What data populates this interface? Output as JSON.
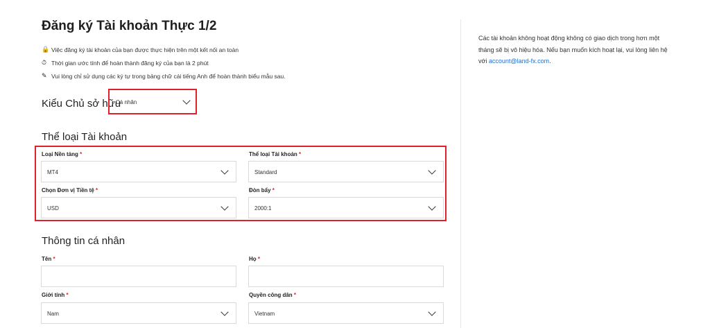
{
  "page": {
    "title": "Đăng ký Tài khoản Thực 1/2",
    "notes": [
      {
        "icon": "lock-icon",
        "glyph": "🔒",
        "text": "Việc đăng ký tài khoản của bạn được thực hiện trên một kết nối an toàn"
      },
      {
        "icon": "stopwatch-icon",
        "glyph": "⏱",
        "text": "Thời gian ước tính để hoàn thành đăng ký của bạn là 2 phút"
      },
      {
        "icon": "pencil-icon",
        "glyph": "✎",
        "text": "Vui lòng chỉ sử dụng các ký tự trong bảng chữ cái tiếng Anh để hoàn thành biểu mẫu sau."
      }
    ]
  },
  "owner": {
    "label": "Kiểu Chủ sở hữu",
    "value": "Cá nhân"
  },
  "account": {
    "heading": "Thể loại Tài khoản",
    "platform": {
      "label": "Loại Nền tảng",
      "value": "MT4"
    },
    "type": {
      "label": "Thể loại Tài khoản",
      "value": "Standard"
    },
    "currency": {
      "label": "Chọn Đơn vị Tiền tệ",
      "value": "USD"
    },
    "leverage": {
      "label": "Đòn bẩy",
      "value": "2000:1"
    }
  },
  "personal": {
    "heading": "Thông tin cá nhân",
    "first_name": {
      "label": "Tên",
      "value": ""
    },
    "last_name": {
      "label": "Họ",
      "value": ""
    },
    "gender": {
      "label": "Giới tính",
      "value": "Nam"
    },
    "citizenship": {
      "label": "Quyền công dân",
      "value": "Vietnam"
    }
  },
  "required_mark": "*",
  "sidebar": {
    "text": "Các tài khoản không hoạt động không có giao dịch trong hơn một tháng sẽ bị vô hiệu hóa. Nếu bạn muốn kích hoạt lại, vui lòng liên hệ với ",
    "email": "account@land-fx.com",
    "end": "."
  },
  "colors": {
    "highlight": "#e0212d",
    "link": "#1f6fd1"
  }
}
